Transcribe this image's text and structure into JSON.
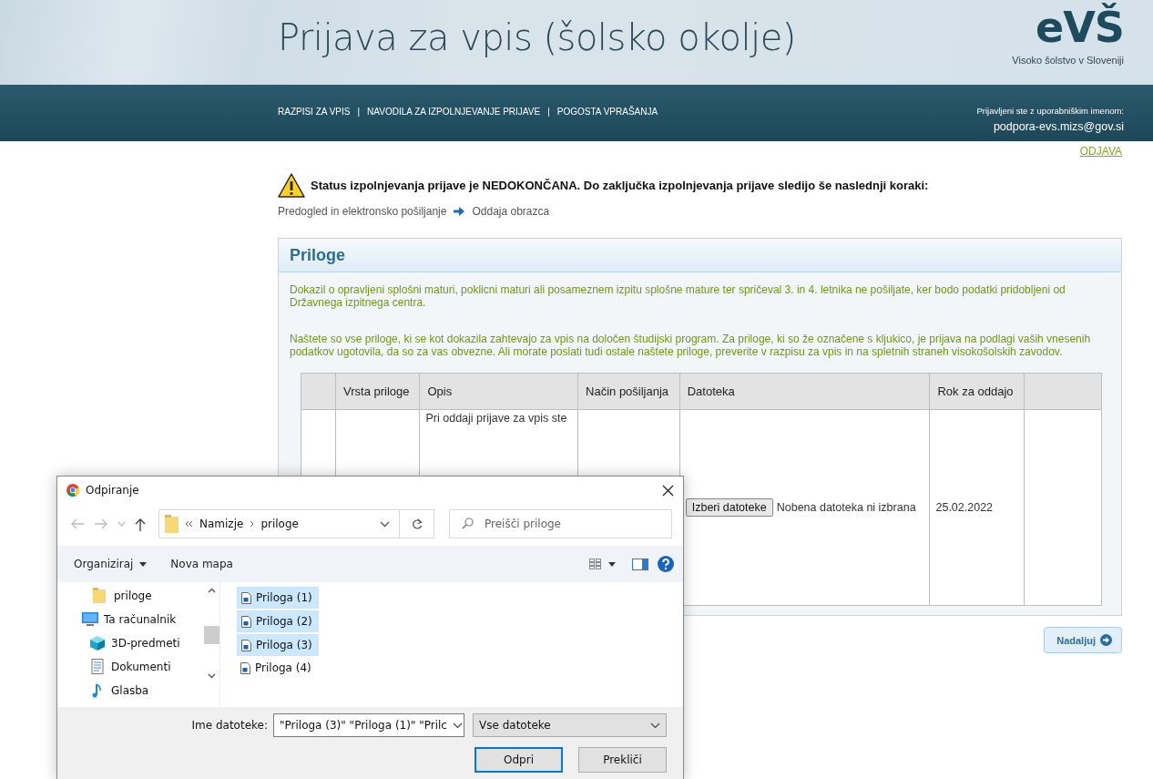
{
  "header": {
    "title": "Prijava za vpis (šolsko okolje)",
    "logo": "eVŠ",
    "logo_subtitle": "Visoko šolstvo v Sloveniji",
    "nav": [
      "RAZPISI ZA VPIS",
      "NAVODILA ZA IZPOLNJEVANJE PRIJAVE",
      "POGOSTA VPRAŠANJA"
    ],
    "nav_separator": "|",
    "user_label": "Prijavljeni ste z uporabniškim imenom:",
    "username": "podpora-evs.mizs@gov.si",
    "logout": "ODJAVA"
  },
  "status": {
    "message": "Status izpolnjevanja prijave je NEDOKONČANA. Do zaključka izpolnjevanja prijave sledijo še naslednji koraki:",
    "steps": [
      "Predogled in elektronsko pošiljanje",
      "Oddaja obrazca"
    ]
  },
  "panel": {
    "title": "Priloge",
    "paragraphs": [
      "Dokazil o opravljeni splošni maturi, poklicni maturi ali posameznem izpitu splošne mature ter spričeval 3. in 4. letnika ne pošiljate, ker bodo podatki pridobljeni od Državnega izpitnega centra.",
      "Naštete so vse priloge, ki se kot dokazila zahtevajo za vpis na določen študijski program. Za priloge, ki so že označene s kljukico, je prijava na podlagi vaših vnesenih podatkov ugotovila, da so za vas obvezne. Ali morate poslati tudi ostale naštete priloge, preverite v razpisu za vpis in na spletnih straneh visokošolskih zavodov."
    ],
    "table": {
      "columns": [
        "Vrsta priloge",
        "Opis",
        "Način pošiljanja",
        "Datoteka",
        "Rok za oddajo"
      ],
      "rows": [
        {
          "opis": "Pri oddaji prijave za vpis ste",
          "file_button": "Izberi datoteke",
          "file_status": "Nobena datoteka ni izbrana",
          "deadline": "25.02.2022"
        }
      ]
    }
  },
  "continue_button": "Nadaljuj",
  "dialog": {
    "title": "Odpiranje",
    "breadcrumb": [
      "Namizje",
      "priloge"
    ],
    "search_placeholder": "Preišči priloge",
    "toolbar": [
      "Organiziraj",
      "Nova mapa"
    ],
    "nav_items": [
      {
        "label": "priloge",
        "kind": "folder"
      },
      {
        "label": "Ta računalnik",
        "kind": "computer"
      },
      {
        "label": "3D-predmeti",
        "kind": "cube"
      },
      {
        "label": "Dokumenti",
        "kind": "document"
      },
      {
        "label": "Glasba",
        "kind": "music"
      }
    ],
    "files": [
      {
        "label": "Priloga (1)",
        "selected": true
      },
      {
        "label": "Priloga (2)",
        "selected": true
      },
      {
        "label": "Priloga (3)",
        "selected": true
      },
      {
        "label": "Priloga (4)",
        "selected": false
      }
    ],
    "filename_label": "Ime datoteke:",
    "filename_value": "\"Priloga (3)\" \"Priloga (1)\" \"Prilc",
    "filetype": "Vse datoteke",
    "open_button": "Odpri",
    "cancel_button": "Prekliči"
  }
}
